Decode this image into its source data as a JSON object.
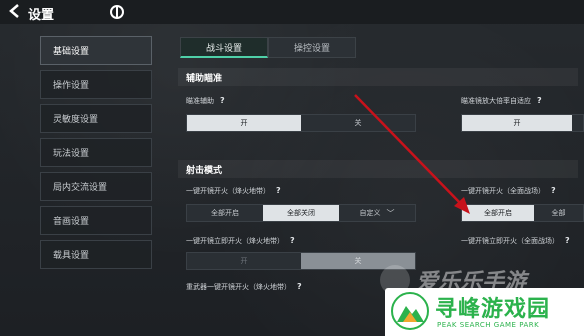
{
  "header": {
    "title": "设置"
  },
  "sidebar": {
    "items": [
      {
        "label": "基础设置",
        "active": true
      },
      {
        "label": "操作设置",
        "active": false
      },
      {
        "label": "灵敏度设置",
        "active": false
      },
      {
        "label": "玩法设置",
        "active": false
      },
      {
        "label": "局内交流设置",
        "active": false
      },
      {
        "label": "音画设置",
        "active": false
      },
      {
        "label": "载具设置",
        "active": false
      }
    ]
  },
  "tabs": [
    {
      "label": "战斗设置",
      "active": true
    },
    {
      "label": "操控设置",
      "active": false
    }
  ],
  "sections": {
    "aim": {
      "title": "辅助瞄准"
    },
    "shoot": {
      "title": "射击模式"
    }
  },
  "settings": {
    "aim_assist": {
      "label": "瞄准辅助",
      "on": "开",
      "off": "关",
      "selected": "开"
    },
    "scope_adapt": {
      "label": "瞄准镜放大倍率自适应",
      "on": "开",
      "selected": "开"
    },
    "scope_fire_beacon": {
      "label": "一键开镜开火（烽火地带）",
      "options": [
        "全部开启",
        "全部关闭",
        "自定义"
      ],
      "selected": "全部关闭"
    },
    "scope_fire_all": {
      "label": "一键开镜开火（全面战场）",
      "options": [
        "全部开启",
        "全部"
      ],
      "selected": "全部开启"
    },
    "scope_instant_beacon": {
      "label": "一键开镜立即开火（烽火地带）",
      "on": "开",
      "off": "关",
      "selected": "关"
    },
    "scope_instant_all": {
      "label": "一键开镜立即开火（全面战场）"
    },
    "sniper_beacon": {
      "label": "重武器一键开镜开火（烽火地带）"
    }
  },
  "help_glyph": "?",
  "chevron_glyph": "﹀",
  "watermarks": {
    "w1": "爱乐乐手游",
    "brand": "寻峰游戏园",
    "brand_sub": "PEAK SEARCH GAME PARK"
  },
  "colors": {
    "accent": "#4fd0a8",
    "arrow": "#c8121b",
    "brand": "#2bb24c"
  }
}
